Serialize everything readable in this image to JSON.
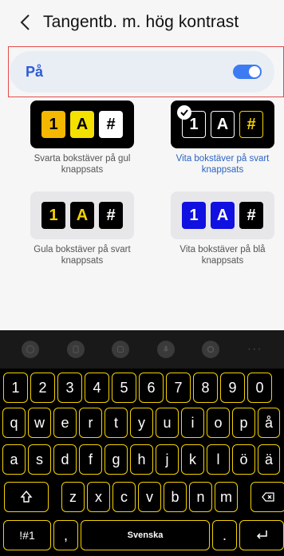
{
  "header": {
    "title": "Tangentb. m. hög kontrast"
  },
  "toggle": {
    "label": "På",
    "state": "on"
  },
  "themes": [
    {
      "label": "Svarta bokstäver på gul knappsats",
      "keys": [
        "1",
        "A",
        "#"
      ],
      "selected": false
    },
    {
      "label": "Vita bokstäver på svart knappsats",
      "keys": [
        "1",
        "A",
        "#"
      ],
      "selected": true
    },
    {
      "label": "Gula bokstäver på svart knappsats",
      "keys": [
        "1",
        "A",
        "#"
      ],
      "selected": false
    },
    {
      "label": "Vita bokstäver på blå knappsats",
      "keys": [
        "1",
        "A",
        "#"
      ],
      "selected": false
    }
  ],
  "keyboard": {
    "toolbar_icons": [
      "emoji-icon",
      "clipboard-icon",
      "sticker-icon",
      "microphone-icon",
      "settings-icon",
      "more-icon"
    ],
    "row1": [
      "1",
      "2",
      "3",
      "4",
      "5",
      "6",
      "7",
      "8",
      "9",
      "0"
    ],
    "row2": [
      "q",
      "w",
      "e",
      "r",
      "t",
      "y",
      "u",
      "i",
      "o",
      "p",
      "å"
    ],
    "row3": [
      "a",
      "s",
      "d",
      "f",
      "g",
      "h",
      "j",
      "k",
      "l",
      "ö",
      "ä"
    ],
    "row4": [
      "z",
      "x",
      "c",
      "v",
      "b",
      "n",
      "m"
    ],
    "symbols_label": "!#1",
    "comma_label": ",",
    "space_label": "Svenska",
    "period_label": ".",
    "more_label": "···"
  },
  "colors": {
    "accent": "#3d7bf3",
    "key_border": "#f4d200",
    "selected_text": "#2b63c6",
    "highlight": "#e54a4a"
  }
}
